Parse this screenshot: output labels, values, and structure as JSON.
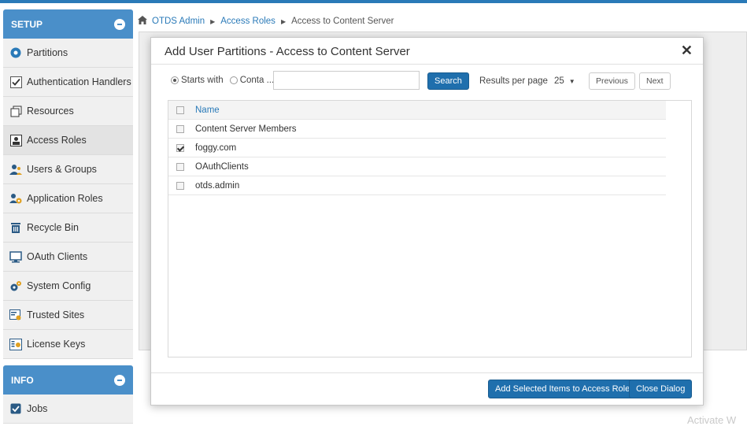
{
  "breadcrumb": {
    "items": [
      "OTDS Admin",
      "Access Roles",
      "Access to Content Server"
    ]
  },
  "sidebar": {
    "setup_title": "SETUP",
    "items": [
      {
        "label": "Partitions",
        "icon": "partitions-icon"
      },
      {
        "label": "Authentication Handlers",
        "icon": "checkbox-icon"
      },
      {
        "label": "Resources",
        "icon": "resources-icon"
      },
      {
        "label": "Access Roles",
        "icon": "access-roles-icon"
      },
      {
        "label": "Users & Groups",
        "icon": "users-icon"
      },
      {
        "label": "Application Roles",
        "icon": "app-roles-icon"
      },
      {
        "label": "Recycle Bin",
        "icon": "trash-icon"
      },
      {
        "label": "OAuth Clients",
        "icon": "monitor-icon"
      },
      {
        "label": "System Config",
        "icon": "gears-icon"
      },
      {
        "label": "Trusted Sites",
        "icon": "trusted-sites-icon"
      },
      {
        "label": "License Keys",
        "icon": "license-icon"
      }
    ],
    "info_title": "INFO",
    "info_items": [
      {
        "label": "Jobs",
        "icon": "jobs-icon"
      }
    ]
  },
  "dialog": {
    "title": "Add User Partitions - Access to Content Server",
    "close_symbol": "✕",
    "filter": {
      "starts_with_label": "Starts with",
      "contains_label": "Conta ...",
      "search_value": "",
      "search_button": "Search",
      "results_label": "Results per page",
      "results_value": "25",
      "previous_button": "Previous",
      "next_button": "Next"
    },
    "table": {
      "header": "Name",
      "rows": [
        {
          "name": "Content Server Members",
          "checked": false
        },
        {
          "name": "foggy.com",
          "checked": true
        },
        {
          "name": "OAuthClients",
          "checked": false
        },
        {
          "name": "otds.admin",
          "checked": false
        }
      ]
    },
    "add_button": "Add Selected Items to Access Role",
    "close_button": "Close Dialog"
  },
  "watermark": "Activate W",
  "colors": {
    "accent": "#4a8fc9",
    "primary_button": "#1f6fad",
    "link": "#2a7ab8"
  }
}
